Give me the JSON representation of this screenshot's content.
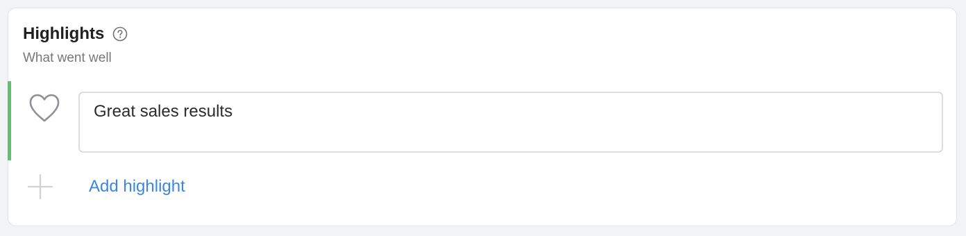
{
  "section": {
    "title": "Highlights",
    "subtitle": "What went well",
    "help_icon": "question-circle-icon"
  },
  "highlights": [
    {
      "icon": "heart-icon",
      "text": "Great sales results",
      "accent_color": "#5cc26e"
    }
  ],
  "add_action": {
    "icon": "plus-icon",
    "label": "Add highlight",
    "color": "#3b87e0"
  }
}
